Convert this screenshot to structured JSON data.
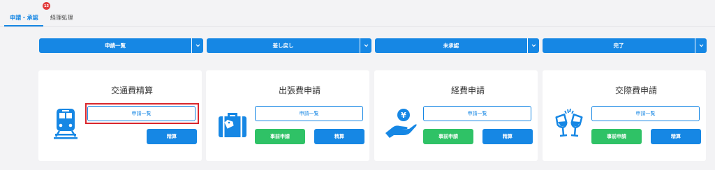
{
  "tabs": [
    {
      "label": "申請・承認",
      "active": true
    },
    {
      "label": "経理処理",
      "active": false
    }
  ],
  "notification_badge": "13",
  "filters": [
    {
      "label": "申請一覧"
    },
    {
      "label": "差し戻し"
    },
    {
      "label": "未承認"
    },
    {
      "label": "完了"
    }
  ],
  "cards": [
    {
      "title": "交通費精算",
      "icon": "train-icon",
      "list_label": "申請一覧",
      "settle_label": "精算",
      "highlighted": true
    },
    {
      "title": "出張費申請",
      "icon": "suitcase-icon",
      "list_label": "申請一覧",
      "pre_label": "事前申請",
      "settle_label": "精算"
    },
    {
      "title": "経費申請",
      "icon": "yen-hand-icon",
      "list_label": "申請一覧",
      "pre_label": "事前申請",
      "settle_label": "精算"
    },
    {
      "title": "交際費申請",
      "icon": "toast-glasses-icon",
      "list_label": "申請一覧",
      "pre_label": "事前申請",
      "settle_label": "精算"
    }
  ],
  "colors": {
    "primary": "#1687e4",
    "success": "#2fc266",
    "badge": "#e23c3c",
    "highlight": "#d9262c",
    "background": "#f3f3f5"
  }
}
